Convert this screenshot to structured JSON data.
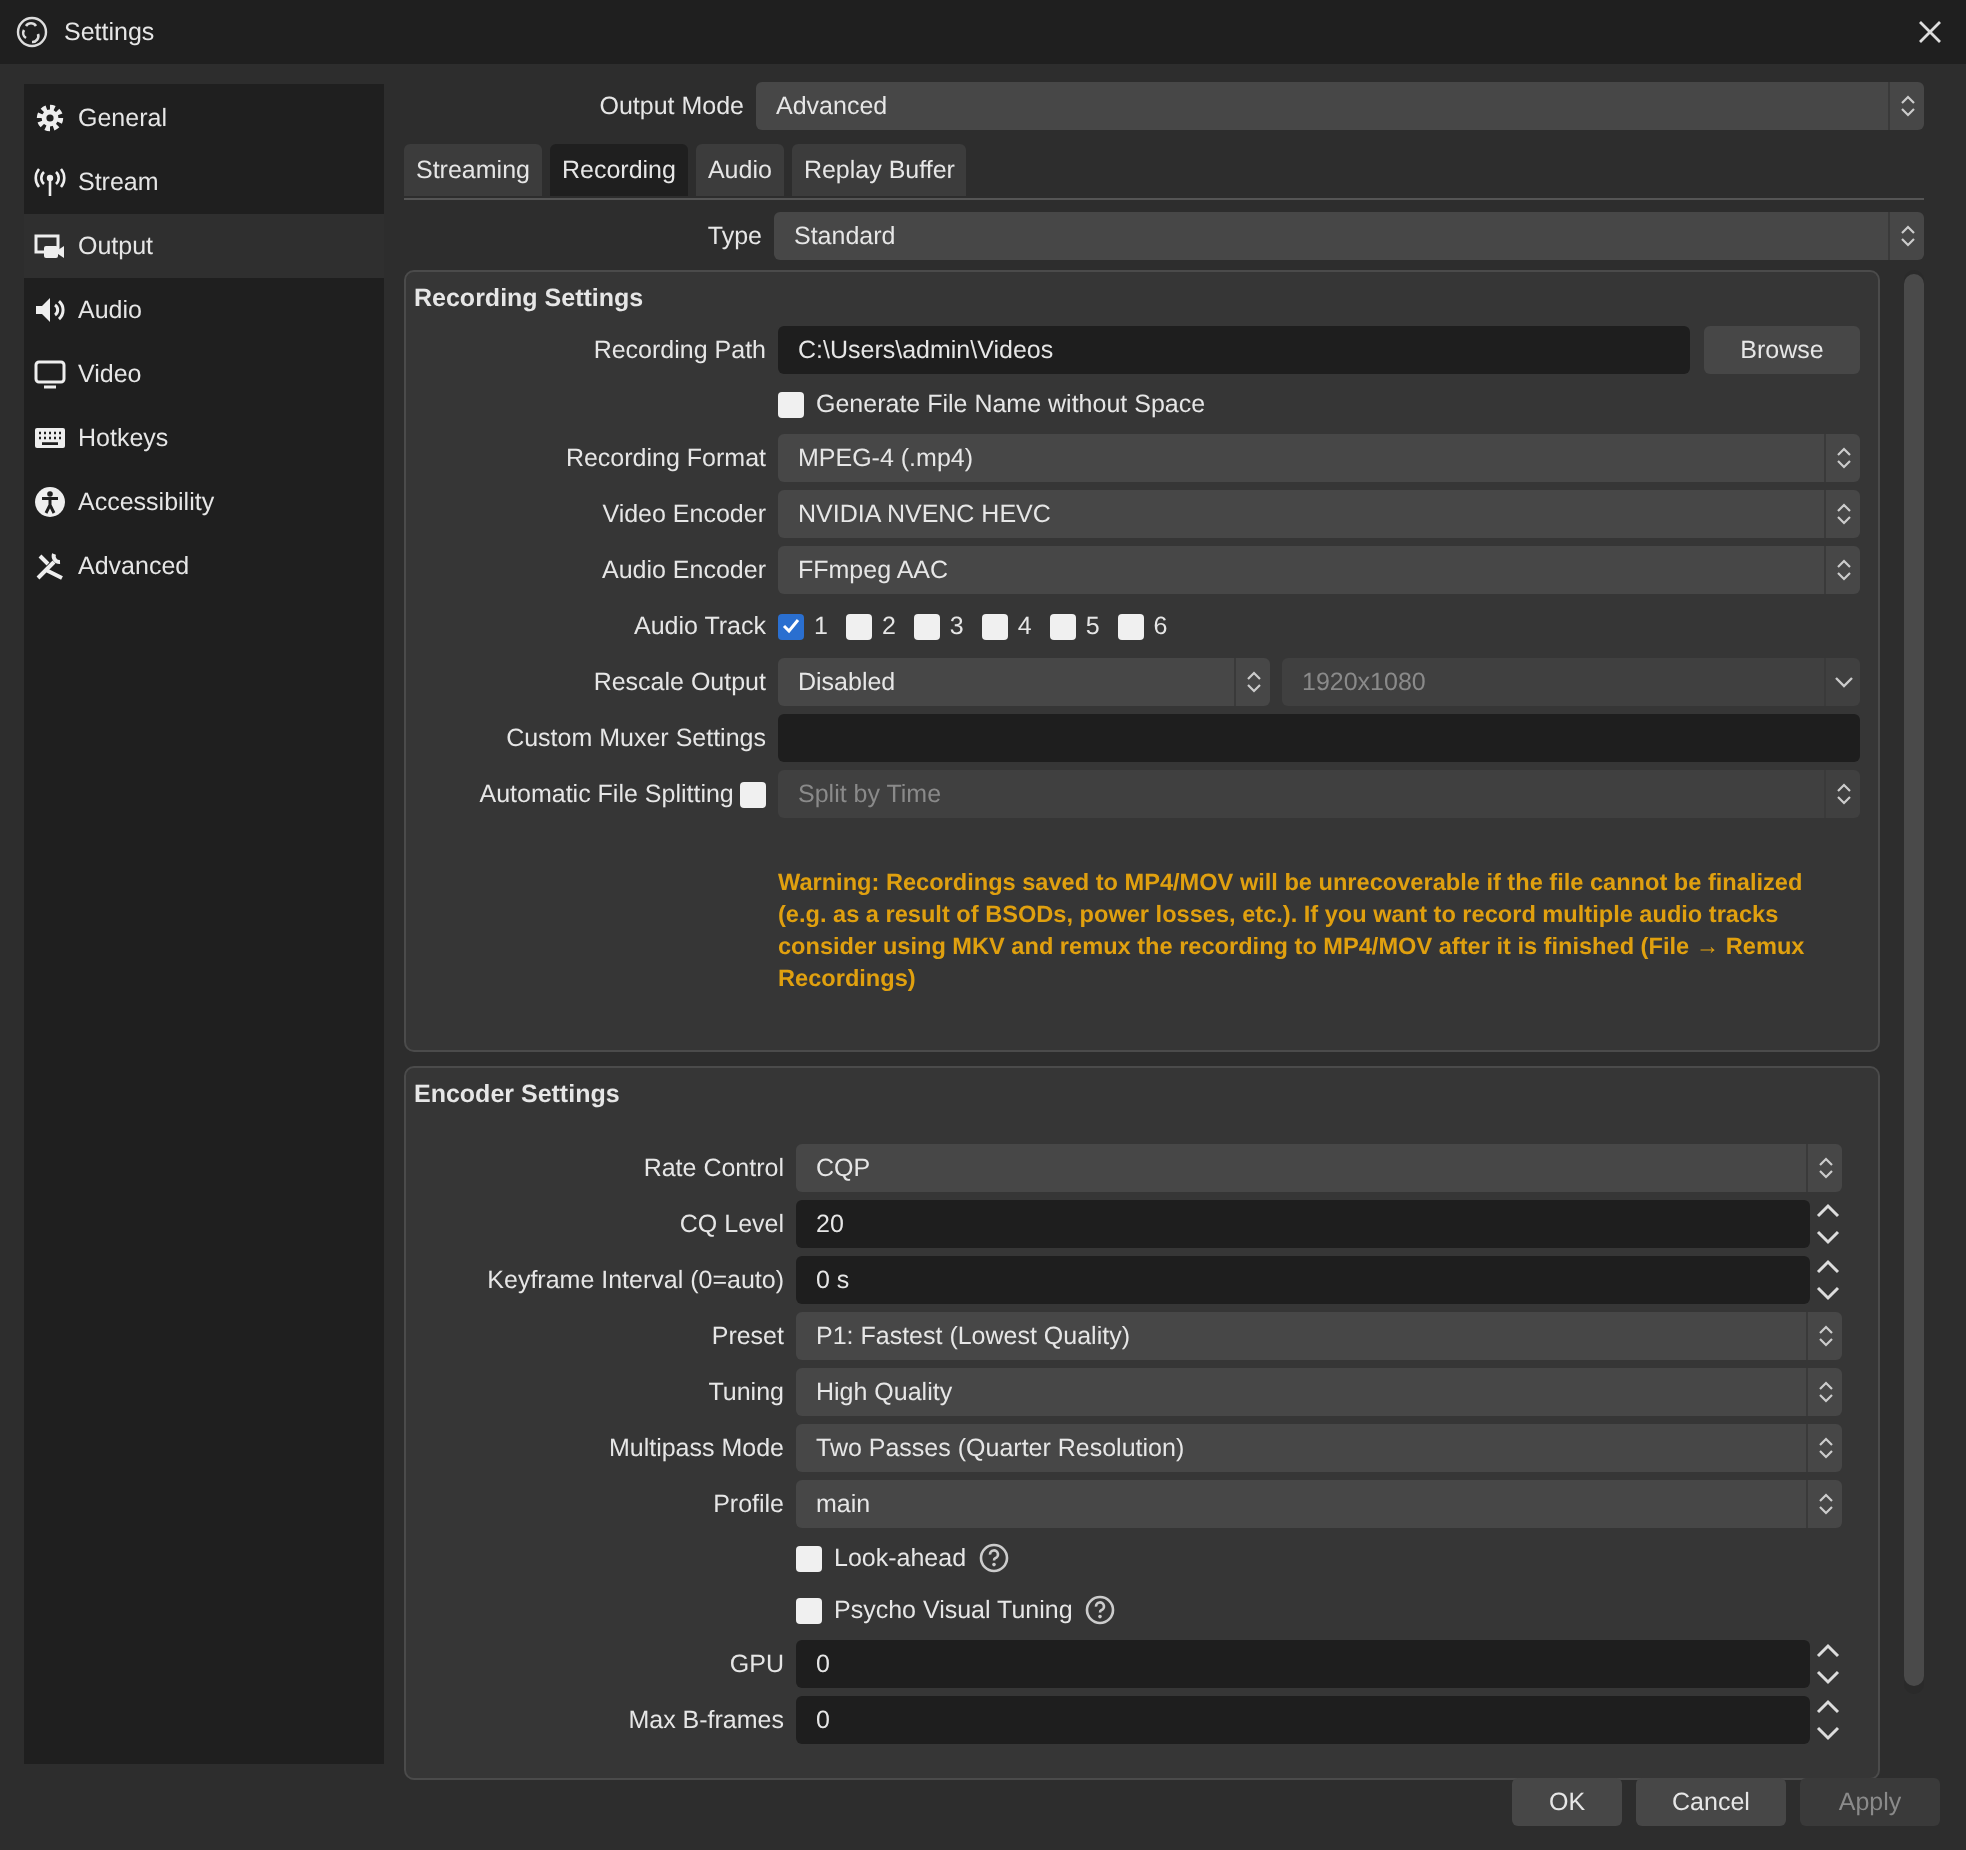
{
  "window": {
    "title": "Settings"
  },
  "sidebar": {
    "items": [
      {
        "label": "General",
        "kind": "gear",
        "selected": false
      },
      {
        "label": "Stream",
        "kind": "antenna",
        "selected": false
      },
      {
        "label": "Output",
        "kind": "output",
        "selected": true
      },
      {
        "label": "Audio",
        "kind": "speaker",
        "selected": false
      },
      {
        "label": "Video",
        "kind": "monitor",
        "selected": false
      },
      {
        "label": "Hotkeys",
        "kind": "keyboard",
        "selected": false
      },
      {
        "label": "Accessibility",
        "kind": "accessibility",
        "selected": false
      },
      {
        "label": "Advanced",
        "kind": "tools",
        "selected": false
      }
    ]
  },
  "output_mode": {
    "label": "Output Mode",
    "value": "Advanced"
  },
  "tabs": [
    {
      "label": "Streaming",
      "selected": false
    },
    {
      "label": "Recording",
      "selected": true
    },
    {
      "label": "Audio",
      "selected": false
    },
    {
      "label": "Replay Buffer",
      "selected": false
    }
  ],
  "type": {
    "label": "Type",
    "value": "Standard"
  },
  "recording_settings": {
    "title": "Recording Settings",
    "rows": [
      {
        "kind": "path",
        "label": "Recording Path",
        "value": "C:\\Users\\admin\\Videos",
        "button": "Browse"
      },
      {
        "kind": "checkbox",
        "label": "Generate File Name without Space",
        "checked": false
      },
      {
        "kind": "select",
        "label": "Recording Format",
        "value": "MPEG-4 (.mp4)",
        "disabled": false
      },
      {
        "kind": "select",
        "label": "Video Encoder",
        "value": "NVIDIA NVENC HEVC",
        "disabled": false
      },
      {
        "kind": "select",
        "label": "Audio Encoder",
        "value": "FFmpeg AAC",
        "disabled": false
      },
      {
        "kind": "tracks",
        "label": "Audio Track",
        "tracks": [
          {
            "label": "1",
            "checked": true
          },
          {
            "label": "2",
            "checked": false
          },
          {
            "label": "3",
            "checked": false
          },
          {
            "label": "4",
            "checked": false
          },
          {
            "label": "5",
            "checked": false
          },
          {
            "label": "6",
            "checked": false
          }
        ]
      },
      {
        "kind": "rescale",
        "label": "Rescale Output",
        "value": "Disabled",
        "resolution": "1920x1080",
        "resolution_disabled": true
      },
      {
        "kind": "text",
        "label": "Custom Muxer Settings"
      },
      {
        "kind": "split",
        "label": "Automatic File Splitting",
        "checked": false,
        "value": "Split by Time",
        "disabled": true
      }
    ],
    "warning": "Warning: Recordings saved to MP4/MOV will be unrecoverable if the file cannot be finalized (e.g. as a result of BSODs, power losses, etc.). If you want to record multiple audio tracks consider using MKV and remux the recording to MP4/MOV after it is finished (File → Remux Recordings)"
  },
  "encoder_settings": {
    "title": "Encoder Settings",
    "rows": [
      {
        "kind": "select",
        "label": "Rate Control",
        "value": "CQP",
        "disabled": false
      },
      {
        "kind": "spin",
        "label": "CQ Level",
        "value": "20"
      },
      {
        "kind": "spin",
        "label": "Keyframe Interval (0=auto)",
        "value": "0 s"
      },
      {
        "kind": "select",
        "label": "Preset",
        "value": "P1: Fastest (Lowest Quality)",
        "disabled": false
      },
      {
        "kind": "select",
        "label": "Tuning",
        "value": "High Quality",
        "disabled": false
      },
      {
        "kind": "select",
        "label": "Multipass Mode",
        "value": "Two Passes (Quarter Resolution)",
        "disabled": false
      },
      {
        "kind": "select",
        "label": "Profile",
        "value": "main",
        "disabled": false
      },
      {
        "kind": "checkbox",
        "label": "Look-ahead",
        "checked": false,
        "help": true
      },
      {
        "kind": "checkbox",
        "label": "Psycho Visual Tuning",
        "checked": false,
        "help": true
      },
      {
        "kind": "spin",
        "label": "GPU",
        "value": "0"
      },
      {
        "kind": "spin",
        "label": "Max B-frames",
        "value": "0"
      }
    ]
  },
  "buttons": [
    {
      "label": "OK",
      "disabled": false
    },
    {
      "label": "Cancel",
      "disabled": false
    },
    {
      "label": "Apply",
      "disabled": true
    }
  ]
}
